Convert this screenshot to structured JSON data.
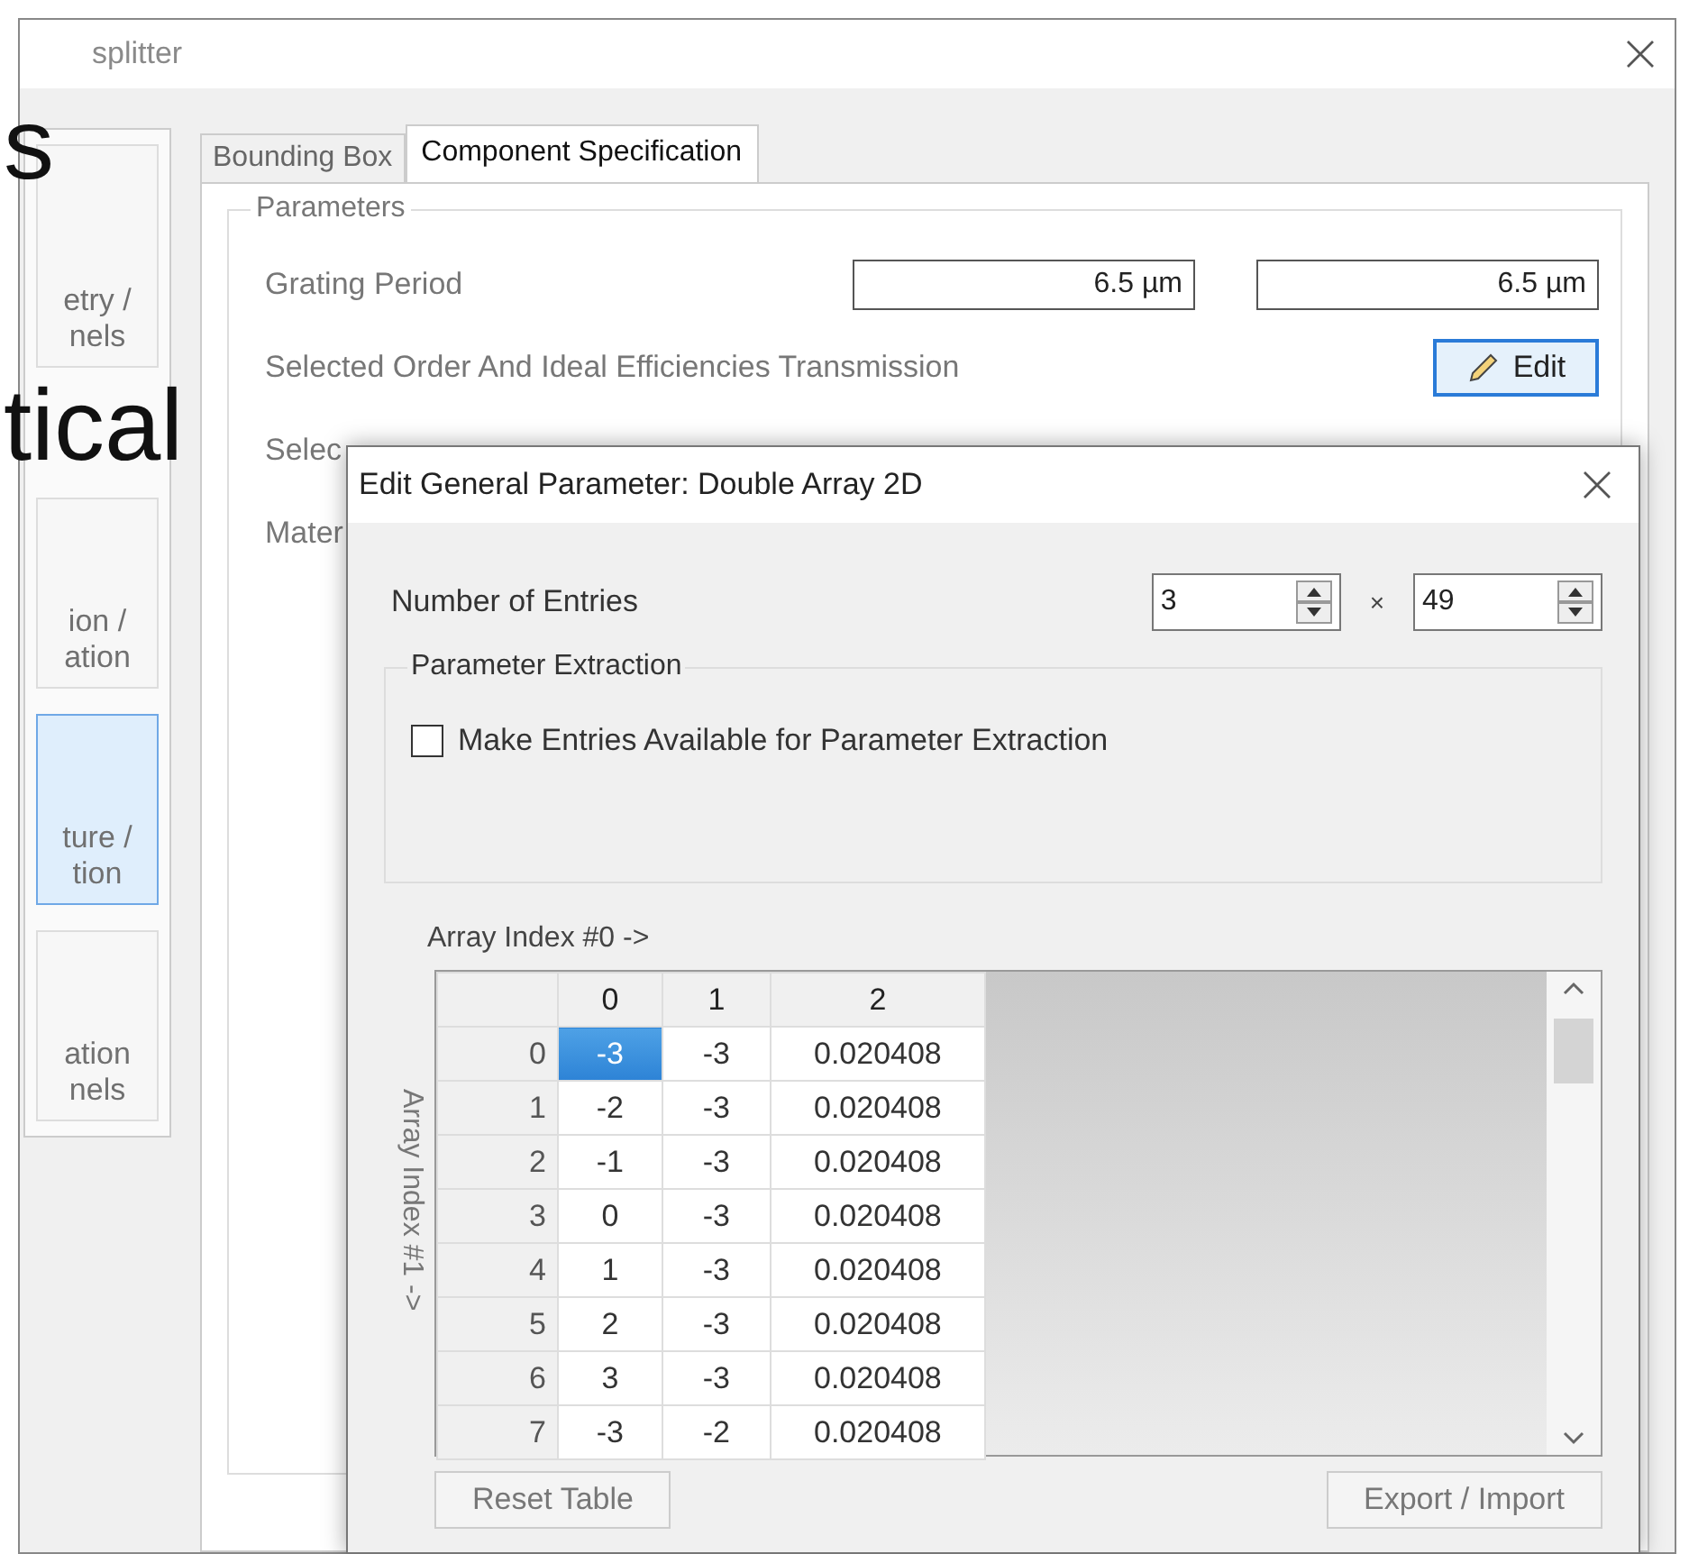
{
  "background_text": [
    "s",
    "tical"
  ],
  "window": {
    "title": "splitter"
  },
  "sidebar": {
    "items": [
      {
        "lines": [
          "etry /",
          "nels"
        ],
        "selected": false
      },
      {
        "lines": [
          "ion /",
          "ation"
        ],
        "selected": false
      },
      {
        "lines": [
          "ture /",
          "tion"
        ],
        "selected": true
      },
      {
        "lines": [
          "ation",
          "nels"
        ],
        "selected": false
      }
    ]
  },
  "tabs": [
    {
      "label": "Bounding Box",
      "selected": false
    },
    {
      "label": "Component Specification",
      "selected": true
    }
  ],
  "parameters": {
    "title": "Parameters",
    "rows": [
      {
        "label": "Grating Period",
        "kind": "fields",
        "values": [
          "6.5 µm",
          "6.5 µm"
        ]
      },
      {
        "label": "Selected Order And Ideal Efficiencies Transmission",
        "kind": "button",
        "button": "Edit"
      },
      {
        "label": "Selec",
        "kind": "text"
      },
      {
        "label": "Mater",
        "kind": "text"
      }
    ]
  },
  "dialog": {
    "title": "Edit General Parameter: Double Array 2D",
    "entries_label": "Number of Entries",
    "entries": [
      "3",
      "49"
    ],
    "times": "×",
    "extraction": {
      "title": "Parameter Extraction",
      "checkbox": {
        "label": "Make Entries Available for Parameter Extraction",
        "checked": false
      }
    },
    "x_axis_label": "Array Index #0 ->",
    "y_axis_label": "Array Index #1 ->",
    "table": {
      "columns": [
        "0",
        "1",
        "2"
      ],
      "rows": [
        {
          "header": "0",
          "cells": [
            "-3",
            "-3",
            "0.020408"
          ],
          "selected": [
            true,
            false,
            false
          ]
        },
        {
          "header": "1",
          "cells": [
            "-2",
            "-3",
            "0.020408"
          ],
          "selected": [
            false,
            false,
            false
          ]
        },
        {
          "header": "2",
          "cells": [
            "-1",
            "-3",
            "0.020408"
          ],
          "selected": [
            false,
            false,
            false
          ]
        },
        {
          "header": "3",
          "cells": [
            "0",
            "-3",
            "0.020408"
          ],
          "selected": [
            false,
            false,
            false
          ]
        },
        {
          "header": "4",
          "cells": [
            "1",
            "-3",
            "0.020408"
          ],
          "selected": [
            false,
            false,
            false
          ]
        },
        {
          "header": "5",
          "cells": [
            "2",
            "-3",
            "0.020408"
          ],
          "selected": [
            false,
            false,
            false
          ]
        },
        {
          "header": "6",
          "cells": [
            "3",
            "-3",
            "0.020408"
          ],
          "selected": [
            false,
            false,
            false
          ]
        },
        {
          "header": "7",
          "cells": [
            "-3",
            "-2",
            "0.020408"
          ],
          "selected": [
            false,
            false,
            false
          ]
        }
      ]
    },
    "buttons": [
      "Reset Table",
      "Export / Import"
    ]
  }
}
